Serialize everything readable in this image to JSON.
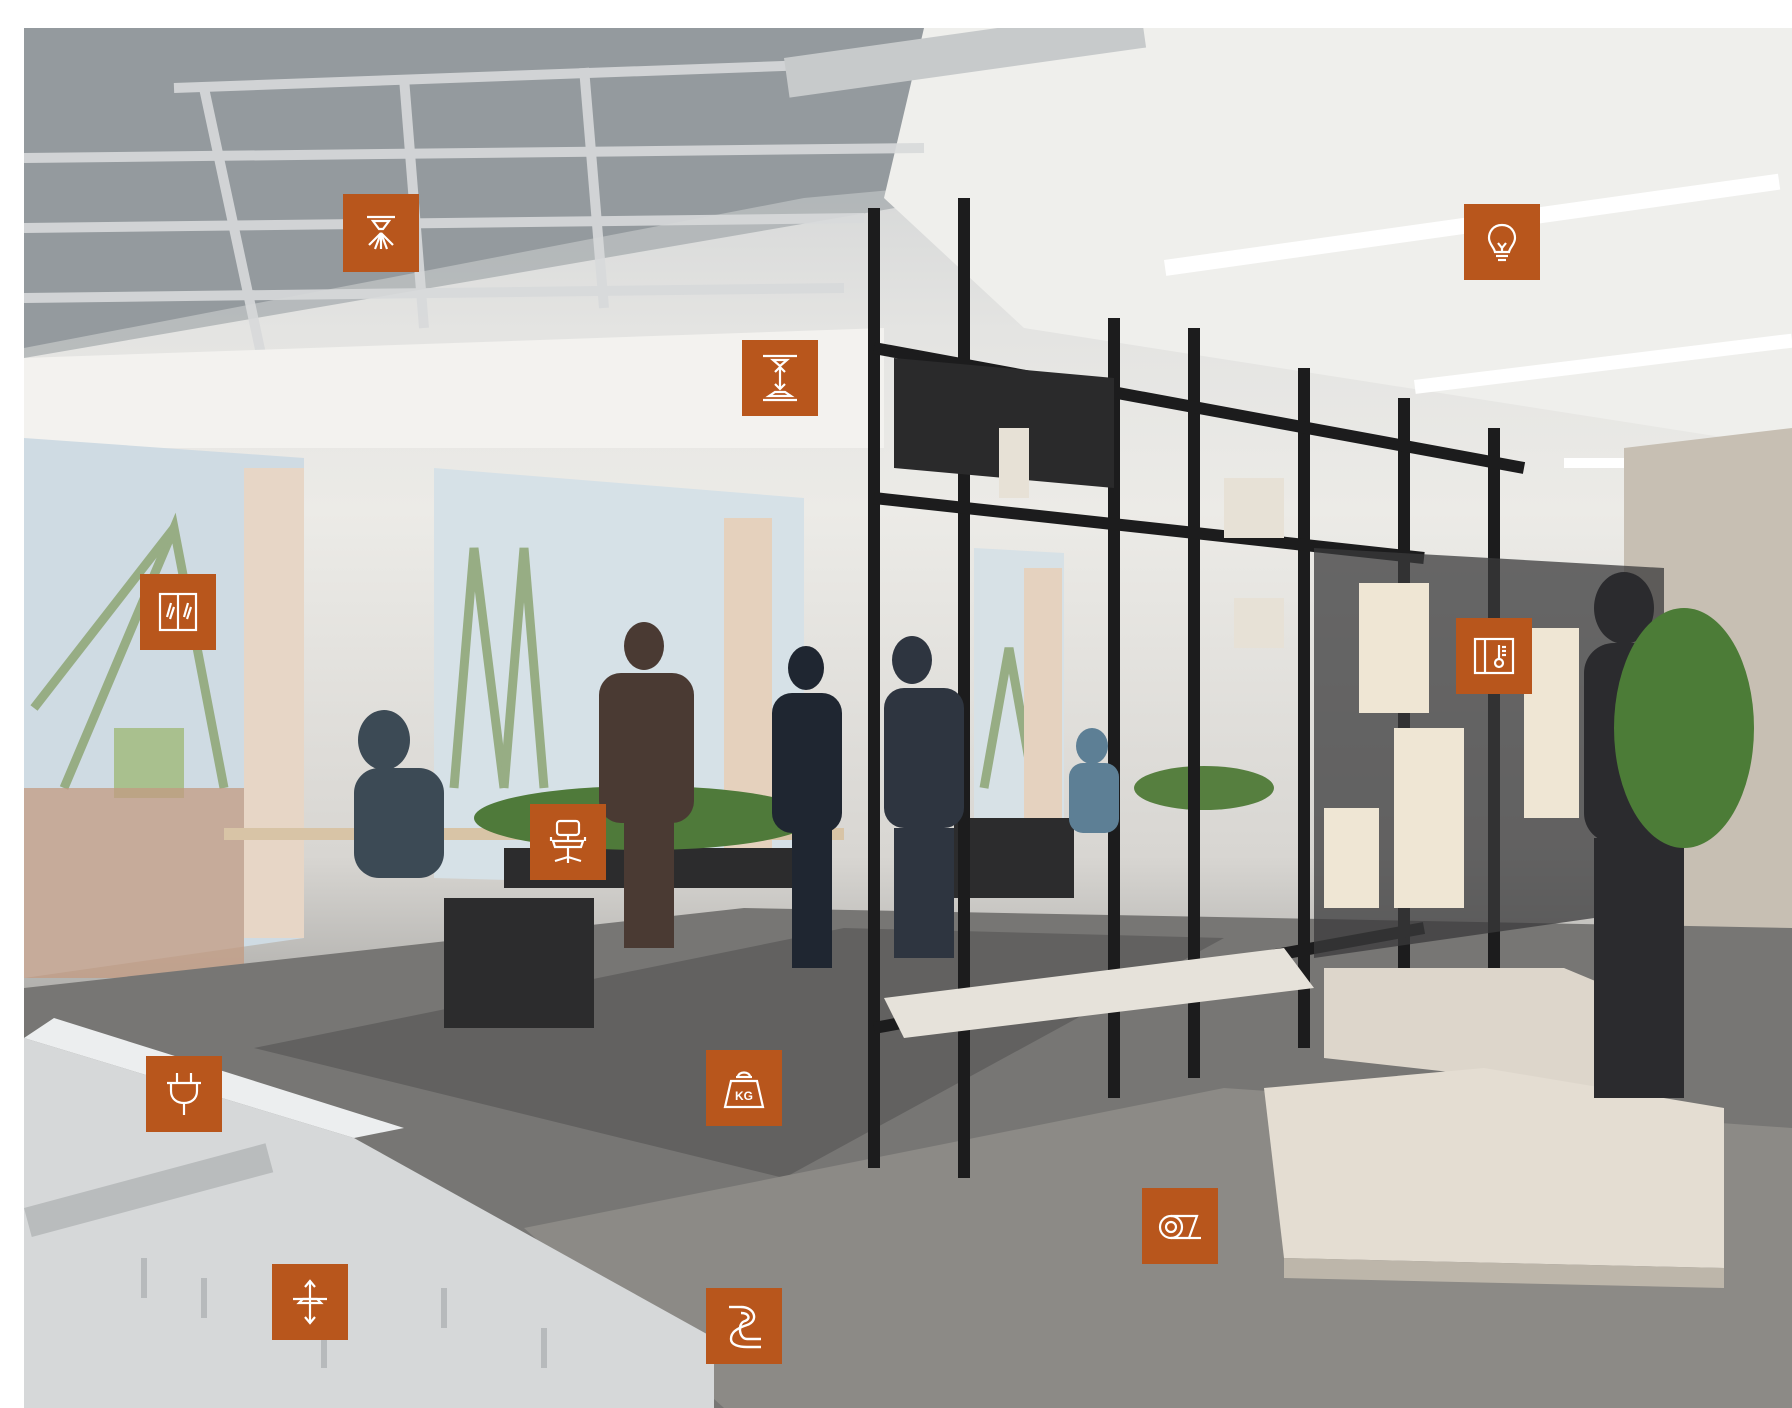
{
  "scene": {
    "description_icon_names": [
      "sprinkler-icon",
      "lightbulb-icon",
      "ceiling-height-icon",
      "window-icon",
      "thermostat-icon",
      "office-chair-icon",
      "power-plug-icon",
      "load-weight-icon",
      "floor-height-icon",
      "cable-routing-icon",
      "flooring-roll-icon"
    ],
    "accent_color": "#b8561c",
    "kg_label": "KG"
  }
}
